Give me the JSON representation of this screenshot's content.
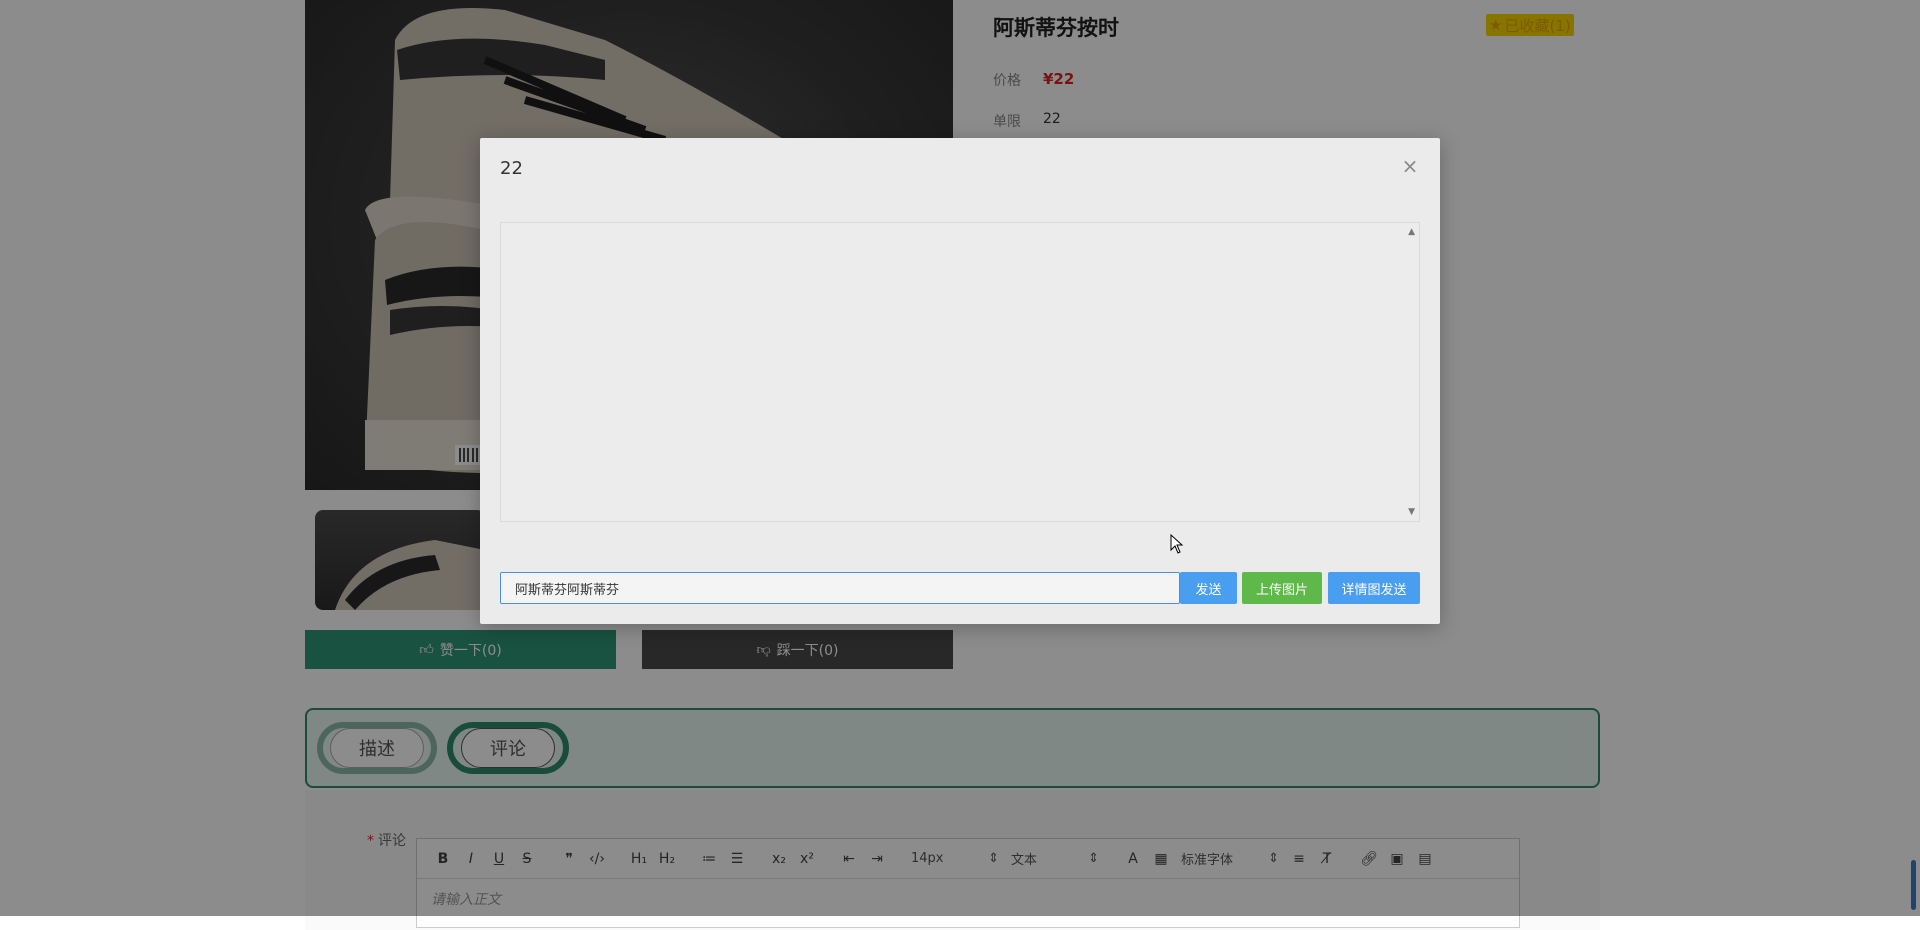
{
  "product": {
    "title": "阿斯蒂芬按时",
    "favorite_label": "已收藏(1)",
    "price_label": "价格",
    "price_value": "¥22",
    "limit_label": "单限",
    "limit_value": "22"
  },
  "votes": {
    "up_label": "赞一下(0)",
    "down_label": "踩一下(0)"
  },
  "tabs": [
    {
      "label": "描述"
    },
    {
      "label": "评论"
    }
  ],
  "comment": {
    "label": "评论",
    "placeholder": "请输入正文",
    "toolbar": {
      "font_size": "14px",
      "block_type": "文本",
      "font_family": "标准字体"
    }
  },
  "modal": {
    "title": "22",
    "input_value": "阿斯蒂芬阿斯蒂芬",
    "send_label": "发送",
    "upload_label": "上传图片",
    "detail_send_label": "详情图发送"
  },
  "colors": {
    "vote_up": "#2f9676",
    "vote_down": "#4a4a4a",
    "send_button": "#4a9ef0",
    "upload_button": "#5eb84a",
    "price": "#e02020",
    "favorite": "#f7d300"
  }
}
